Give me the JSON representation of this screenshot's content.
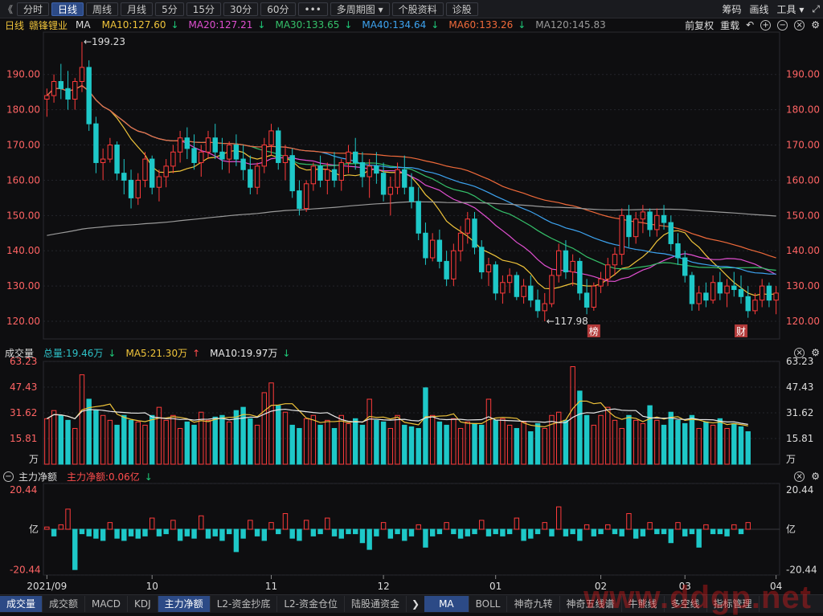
{
  "toolbar": {
    "back_label": "《",
    "periods": [
      "分时",
      "日线",
      "周线",
      "月线",
      "5分",
      "15分",
      "30分",
      "60分"
    ],
    "active_period": 1,
    "more_label": "•••",
    "multi_period_label": "多周期图",
    "info_label": "个股资料",
    "diagnose_label": "诊股",
    "right": {
      "chips": "筹码",
      "draw": "画线",
      "tools": "工具"
    }
  },
  "price_legend": {
    "period": "日线",
    "name": "赣锋锂业",
    "ma_label": "MA",
    "items": [
      {
        "label": "MA10:127.60",
        "color": "#f0c43a"
      },
      {
        "label": "MA20:127.21",
        "color": "#e04fd0"
      },
      {
        "label": "MA30:133.65",
        "color": "#35c16a"
      },
      {
        "label": "MA40:134.64",
        "color": "#3da3f0"
      },
      {
        "label": "MA60:133.26",
        "color": "#f06a3a"
      },
      {
        "label": "MA120:145.83",
        "color": "#9a9a9a"
      }
    ],
    "right": {
      "adjust": "前复权",
      "weight": "重载"
    }
  },
  "volume_legend": {
    "title": "成交量",
    "items": [
      {
        "label": "总量:19.46万",
        "color": "#2ec2c8"
      },
      {
        "label": "MA5:21.30万",
        "color": "#f0c43a"
      },
      {
        "label": "MA10:19.97万",
        "color": "#e8e8e8"
      }
    ]
  },
  "flow_legend": {
    "title": "主力净额",
    "items": [
      {
        "label": "主力净额:0.06亿",
        "color": "#ff4d4d"
      }
    ]
  },
  "colors": {
    "up": "#ff3b3b",
    "down": "#1ec8c8",
    "ma5": "#f0c43a",
    "ma10_vol": "#e8e8e8",
    "highlight": "#e83a3a",
    "axis_text": "#ff6464"
  },
  "chart_data": [
    {
      "type": "candlestick",
      "yticks": [
        190,
        180,
        170,
        160,
        150,
        140,
        130,
        120
      ],
      "ytick_labels": [
        "190.00",
        "180.00",
        "170.00",
        "160.00",
        "150.00",
        "140.00",
        "130.00",
        "120.00"
      ],
      "ylim": [
        115,
        202
      ],
      "annotations": {
        "high": "←199.23",
        "low": "←117.98",
        "marker_a": "榜",
        "marker_b": "财"
      },
      "highlight_box": {
        "from_index": 140,
        "to_index": 150,
        "y_range": [
          120.5,
          134.2
        ]
      },
      "ohlc": [
        [
          183,
          186,
          178,
          184
        ],
        [
          184,
          190,
          182,
          188
        ],
        [
          188,
          193,
          183,
          186
        ],
        [
          186,
          191,
          180,
          183
        ],
        [
          183,
          189,
          180,
          188
        ],
        [
          188,
          199.23,
          185,
          192
        ],
        [
          192,
          194,
          174,
          176
        ],
        [
          176,
          178,
          162,
          165
        ],
        [
          165,
          169,
          160,
          166
        ],
        [
          166,
          172,
          165,
          170
        ],
        [
          170,
          171,
          160,
          162
        ],
        [
          162,
          166,
          156,
          160
        ],
        [
          160,
          163,
          152,
          155
        ],
        [
          155,
          162,
          153,
          160
        ],
        [
          160,
          168,
          158,
          166
        ],
        [
          166,
          167,
          156,
          158
        ],
        [
          158,
          163,
          154,
          161
        ],
        [
          161,
          166,
          158,
          164
        ],
        [
          164,
          170,
          162,
          168
        ],
        [
          168,
          174,
          165,
          172
        ],
        [
          172,
          175,
          166,
          169
        ],
        [
          169,
          173,
          163,
          165
        ],
        [
          165,
          170,
          161,
          168
        ],
        [
          168,
          174,
          166,
          172
        ],
        [
          172,
          176,
          166,
          168
        ],
        [
          168,
          172,
          163,
          166
        ],
        [
          166,
          171,
          162,
          170
        ],
        [
          170,
          173,
          164,
          166
        ],
        [
          166,
          170,
          160,
          163
        ],
        [
          163,
          167,
          156,
          158
        ],
        [
          158,
          165,
          156,
          164
        ],
        [
          164,
          172,
          162,
          170
        ],
        [
          170,
          176,
          167,
          174
        ],
        [
          174,
          175,
          163,
          165
        ],
        [
          165,
          170,
          160,
          167
        ],
        [
          167,
          169,
          155,
          157
        ],
        [
          157,
          160,
          150,
          152
        ],
        [
          152,
          160,
          151,
          159
        ],
        [
          159,
          165,
          157,
          164
        ],
        [
          164,
          167,
          158,
          160
        ],
        [
          160,
          165,
          156,
          163
        ],
        [
          163,
          168,
          158,
          160
        ],
        [
          160,
          166,
          157,
          165
        ],
        [
          165,
          170,
          162,
          168
        ],
        [
          168,
          172,
          163,
          165
        ],
        [
          165,
          168,
          158,
          161
        ],
        [
          161,
          166,
          155,
          164
        ],
        [
          164,
          168,
          159,
          162
        ],
        [
          162,
          165,
          154,
          156
        ],
        [
          156,
          161,
          150,
          158
        ],
        [
          158,
          165,
          156,
          163
        ],
        [
          163,
          167,
          156,
          158
        ],
        [
          158,
          162,
          152,
          154
        ],
        [
          154,
          158,
          143,
          145
        ],
        [
          145,
          148,
          136,
          138
        ],
        [
          138,
          145,
          137,
          143
        ],
        [
          143,
          146,
          135,
          137
        ],
        [
          137,
          140,
          130,
          132
        ],
        [
          132,
          142,
          130,
          140
        ],
        [
          140,
          147,
          137,
          145
        ],
        [
          145,
          151,
          142,
          149
        ],
        [
          149,
          151,
          139,
          141
        ],
        [
          141,
          143,
          132,
          134
        ],
        [
          134,
          138,
          130,
          136
        ],
        [
          136,
          137,
          126,
          128
        ],
        [
          128,
          133,
          125,
          131
        ],
        [
          131,
          135,
          128,
          133
        ],
        [
          133,
          134,
          126,
          127
        ],
        [
          127,
          132,
          125,
          130
        ],
        [
          130,
          133,
          124,
          126
        ],
        [
          126,
          129,
          121,
          123
        ],
        [
          123,
          128,
          120,
          125
        ],
        [
          125,
          135,
          124,
          133
        ],
        [
          133,
          142,
          131,
          140
        ],
        [
          140,
          143,
          132,
          134
        ],
        [
          134,
          139,
          130,
          137
        ],
        [
          137,
          138,
          126,
          128
        ],
        [
          128,
          132,
          122,
          124
        ],
        [
          124,
          131,
          123,
          130
        ],
        [
          130,
          134,
          128,
          132
        ],
        [
          132,
          138,
          130,
          136
        ],
        [
          136,
          141,
          133,
          139
        ],
        [
          139,
          152,
          136,
          150
        ],
        [
          150,
          153,
          141,
          144
        ],
        [
          144,
          151,
          142,
          149
        ],
        [
          149,
          153,
          145,
          151
        ],
        [
          151,
          152,
          144,
          146
        ],
        [
          146,
          152,
          144,
          150
        ],
        [
          150,
          153,
          146,
          148
        ],
        [
          148,
          150,
          140,
          142
        ],
        [
          142,
          145,
          136,
          138
        ],
        [
          138,
          140,
          131,
          133
        ],
        [
          133,
          134,
          123,
          125
        ],
        [
          125,
          130,
          123,
          128
        ],
        [
          128,
          131,
          124,
          126
        ],
        [
          126,
          133,
          125,
          131
        ],
        [
          131,
          134,
          126,
          128
        ],
        [
          128,
          132,
          124,
          130
        ],
        [
          130,
          134,
          127,
          129
        ],
        [
          129,
          133,
          125,
          127
        ],
        [
          127,
          130,
          121,
          123
        ],
        [
          123,
          128,
          122,
          126
        ],
        [
          126,
          132,
          124,
          130
        ],
        [
          130,
          131,
          124,
          126
        ],
        [
          126,
          130,
          122,
          128
        ]
      ]
    },
    {
      "type": "bar",
      "name": "成交量",
      "unit": "万",
      "yticks": [
        63.23,
        47.43,
        31.62,
        15.81
      ],
      "ytick_labels": [
        "63.23",
        "47.43",
        "31.62",
        "15.81"
      ],
      "ylim": [
        0,
        63.23
      ],
      "values": [
        28,
        33,
        30,
        27,
        22,
        55,
        40,
        33,
        30,
        27,
        24,
        30,
        27,
        26,
        24,
        30,
        35,
        27,
        30,
        22,
        26,
        24,
        32,
        27,
        29,
        30,
        26,
        33,
        35,
        28,
        24,
        44,
        50,
        36,
        32,
        24,
        22,
        28,
        30,
        24,
        27,
        22,
        30,
        25,
        28,
        24,
        40,
        27,
        26,
        22,
        30,
        24,
        23,
        22,
        47,
        30,
        26,
        24,
        28,
        22,
        26,
        25,
        24,
        40,
        27,
        28,
        24,
        22,
        26,
        20,
        25,
        22,
        30,
        32,
        27,
        60,
        45,
        30,
        24,
        30,
        35,
        27,
        22,
        30,
        27,
        25,
        36,
        27,
        24,
        32,
        27,
        25,
        30,
        22,
        26,
        24,
        28,
        22,
        25,
        23,
        20
      ]
    },
    {
      "type": "bar",
      "name": "主力净额",
      "unit": "亿",
      "yticks": [
        20.44,
        -20.44
      ],
      "ytick_labels": [
        "20.44",
        "-20.44"
      ],
      "ylim": [
        -20.44,
        20.44
      ],
      "values": [
        1,
        -3,
        2,
        9,
        -18,
        -2,
        -3,
        -4,
        -5,
        3,
        -4,
        -5,
        -3,
        -4,
        -3,
        5,
        -3,
        -2,
        4,
        -5,
        -3,
        -4,
        6,
        -4,
        -3,
        -5,
        -2,
        -10,
        -4,
        4,
        -3,
        -5,
        3,
        -2,
        7,
        -4,
        -5,
        4,
        -3,
        -2,
        5,
        -3,
        -4,
        -2,
        -2,
        -6,
        -9,
        -3,
        3,
        -4,
        -2,
        -5,
        -3,
        2,
        -8,
        -3,
        -2,
        3,
        -2,
        -4,
        -3,
        -2,
        4,
        -3,
        -2,
        -3,
        -2,
        5,
        -5,
        -4,
        -2,
        3,
        -3,
        10,
        -3,
        -2,
        -5,
        2,
        -3,
        -2,
        2,
        -2,
        -3,
        7,
        -4,
        -3,
        3,
        -2,
        -2,
        -6,
        3,
        -3,
        -2,
        -8,
        2,
        -2,
        -2,
        -3,
        2,
        -2,
        3
      ]
    }
  ],
  "x_axis": {
    "labels": [
      {
        "text": "2021/09",
        "index": 0
      },
      {
        "text": "10",
        "index": 15
      },
      {
        "text": "11",
        "index": 32
      },
      {
        "text": "12",
        "index": 48
      },
      {
        "text": "01",
        "index": 64
      },
      {
        "text": "02",
        "index": 79
      },
      {
        "text": "03",
        "index": 91
      },
      {
        "text": "04",
        "index": 110
      }
    ]
  },
  "bottom_tabs": [
    "成交量",
    "成交额",
    "MACD",
    "KDJ",
    "主力净额",
    "L2-资金抄底",
    "L2-资金仓位",
    "陆股通资金"
  ],
  "bottom_tabs_active": [
    0,
    4
  ],
  "bottom_arrow": "❯",
  "indicator_tabs": [
    "MA",
    "BOLL",
    "神奇九转",
    "神奇五线谱",
    "牛熊线",
    "多空线",
    "指标管理"
  ],
  "indicator_tabs_active": 0,
  "watermark": "www.ddgp.net"
}
